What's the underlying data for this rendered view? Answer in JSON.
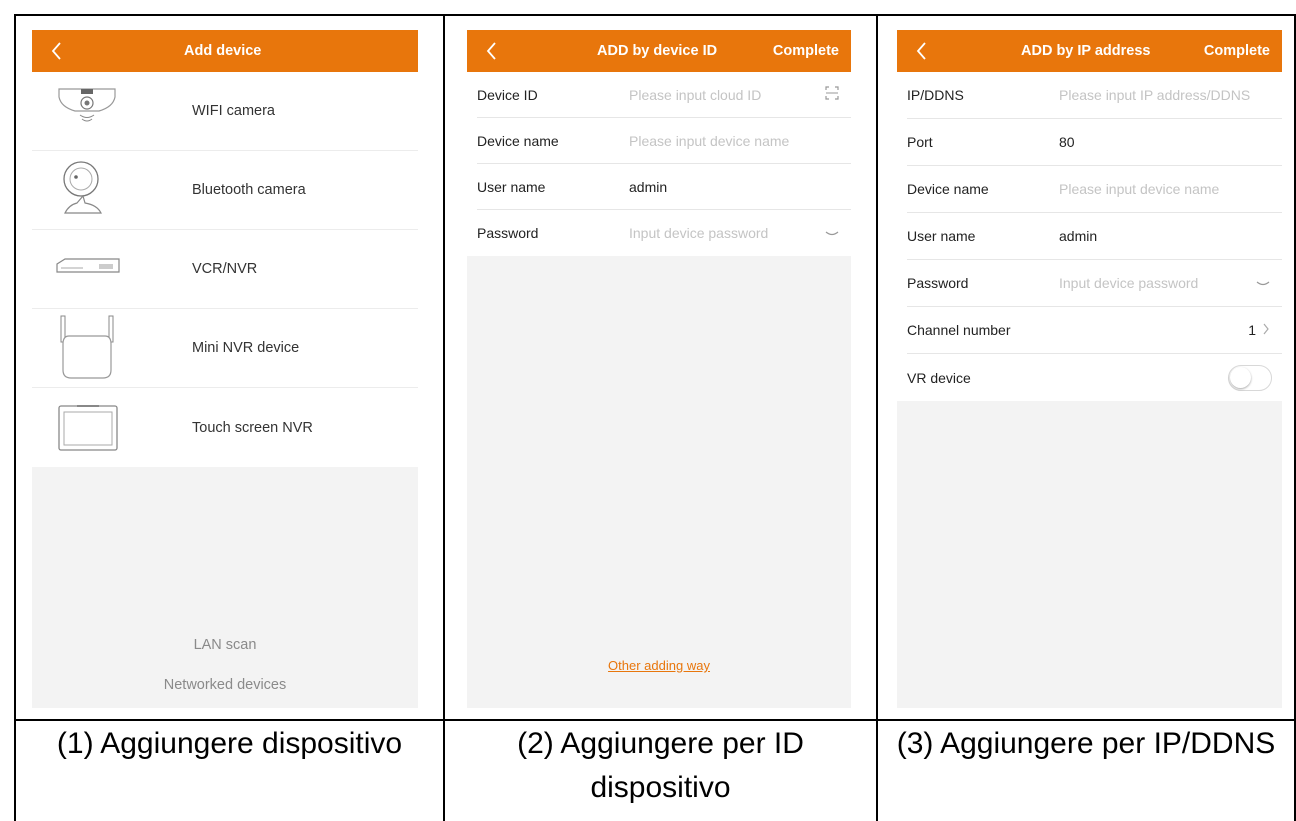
{
  "panel1": {
    "title": "Add device",
    "devices": [
      {
        "label": "WIFI camera",
        "icon": "wifi-camera-icon"
      },
      {
        "label": "Bluetooth camera",
        "icon": "bluetooth-camera-icon"
      },
      {
        "label": "VCR/NVR",
        "icon": "nvr-recorder-icon"
      },
      {
        "label": "Mini NVR device",
        "icon": "mini-nvr-icon"
      },
      {
        "label": "Touch screen NVR",
        "icon": "touch-screen-nvr-icon"
      }
    ],
    "lan_scan": "LAN scan",
    "networked_devices": "Networked devices",
    "caption": "(1) Aggiungere dispositivo"
  },
  "panel2": {
    "title": "ADD by device ID",
    "complete": "Complete",
    "fields": {
      "device_id": {
        "label": "Device ID",
        "placeholder": "Please input cloud ID"
      },
      "device_name": {
        "label": "Device name",
        "placeholder": "Please input device name"
      },
      "user_name": {
        "label": "User name",
        "value": "admin"
      },
      "password": {
        "label": "Password",
        "placeholder": "Input device password"
      }
    },
    "other_way": "Other adding way",
    "caption": "(2) Aggiungere per ID dispositivo"
  },
  "panel3": {
    "title": "ADD by IP address",
    "complete": "Complete",
    "fields": {
      "ip": {
        "label": "IP/DDNS",
        "placeholder": "Please input IP address/DDNS"
      },
      "port": {
        "label": "Port",
        "value": "80"
      },
      "device_name": {
        "label": "Device name",
        "placeholder": "Please input device name"
      },
      "user_name": {
        "label": "User name",
        "value": "admin"
      },
      "password": {
        "label": "Password",
        "placeholder": "Input device password"
      },
      "channel": {
        "label": "Channel number",
        "value": "1"
      },
      "vr": {
        "label": "VR device",
        "enabled": false
      }
    },
    "caption": "(3) Aggiungere per IP/DDNS"
  },
  "colors": {
    "accent": "#e8760c",
    "background": "#f3f3f3"
  }
}
